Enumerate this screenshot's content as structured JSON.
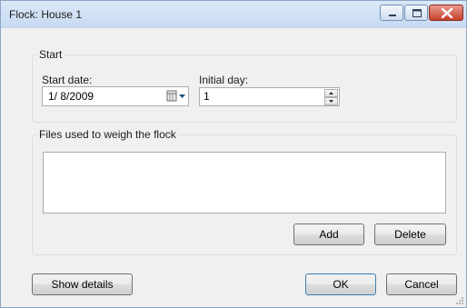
{
  "window": {
    "title": "Flock: House 1",
    "buttons": [
      "minimize-icon",
      "maximize-icon",
      "close-icon"
    ]
  },
  "start_group": {
    "legend": "Start",
    "start_date_label": "Start date:",
    "start_date_value": "1/ 8/2009",
    "initial_day_label": "Initial day:",
    "initial_day_value": "1"
  },
  "files_group": {
    "legend": "Files used to weigh the flock",
    "files": [],
    "add_label": "Add",
    "delete_label": "Delete"
  },
  "footer": {
    "show_details_label": "Show details",
    "ok_label": "OK",
    "cancel_label": "Cancel"
  },
  "colors": {
    "titlebar": "#c7daf2",
    "close_button": "#c5412c",
    "dialog_background": "#f0f0f0"
  }
}
